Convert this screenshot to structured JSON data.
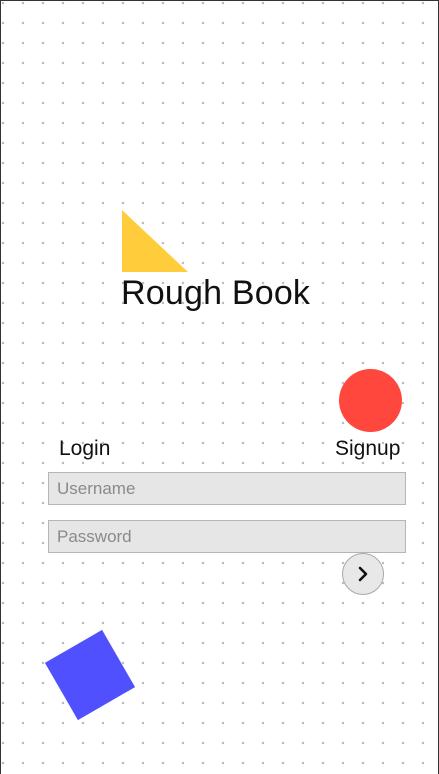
{
  "app": {
    "title": "Rough Book"
  },
  "tabs": {
    "login_label": "Login",
    "signup_label": "Signup"
  },
  "form": {
    "username": {
      "value": "",
      "placeholder": "Username"
    },
    "password": {
      "value": "",
      "placeholder": "Password"
    },
    "submit_icon": "chevron-right-icon"
  },
  "decorations": {
    "triangle_color": "#ffcd3c",
    "circle_color": "#ff473d",
    "square_color": "#5050ff"
  }
}
